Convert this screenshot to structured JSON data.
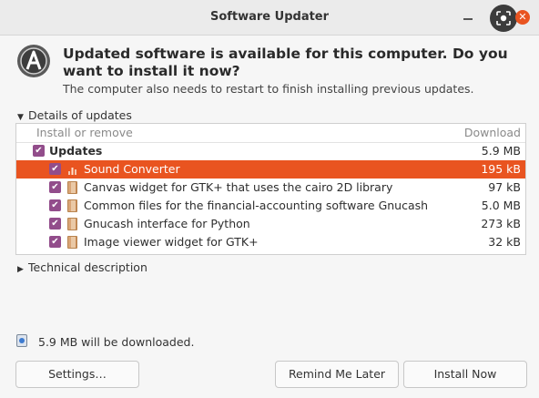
{
  "window": {
    "title": "Software Updater"
  },
  "header": {
    "headline": "Updated software is available for this computer. Do you want to install it now?",
    "subtext": "The computer also needs to restart to finish installing previous updates."
  },
  "details_expander": {
    "label": "Details of updates"
  },
  "table": {
    "col_install": "Install or remove",
    "col_download": "Download",
    "group": {
      "name": "Updates",
      "size": "5.9 MB",
      "checked": true
    },
    "rows": [
      {
        "name": "Sound Converter",
        "size": "195 kB",
        "checked": true,
        "selected": true
      },
      {
        "name": "Canvas widget for GTK+ that uses the cairo 2D library",
        "size": "97 kB",
        "checked": true
      },
      {
        "name": "Common files for the financial-accounting software Gnucash",
        "size": "5.0 MB",
        "checked": true
      },
      {
        "name": "Gnucash interface for Python",
        "size": "273 kB",
        "checked": true
      },
      {
        "name": "Image viewer widget for GTK+",
        "size": "32 kB",
        "checked": true
      }
    ]
  },
  "technical_expander": {
    "label": "Technical description"
  },
  "download_info": "5.9 MB will be downloaded.",
  "buttons": {
    "settings": "Settings…",
    "remind": "Remind Me Later",
    "install": "Install Now"
  },
  "colors": {
    "accent": "#e95420",
    "checkbox": "#924d8b"
  }
}
